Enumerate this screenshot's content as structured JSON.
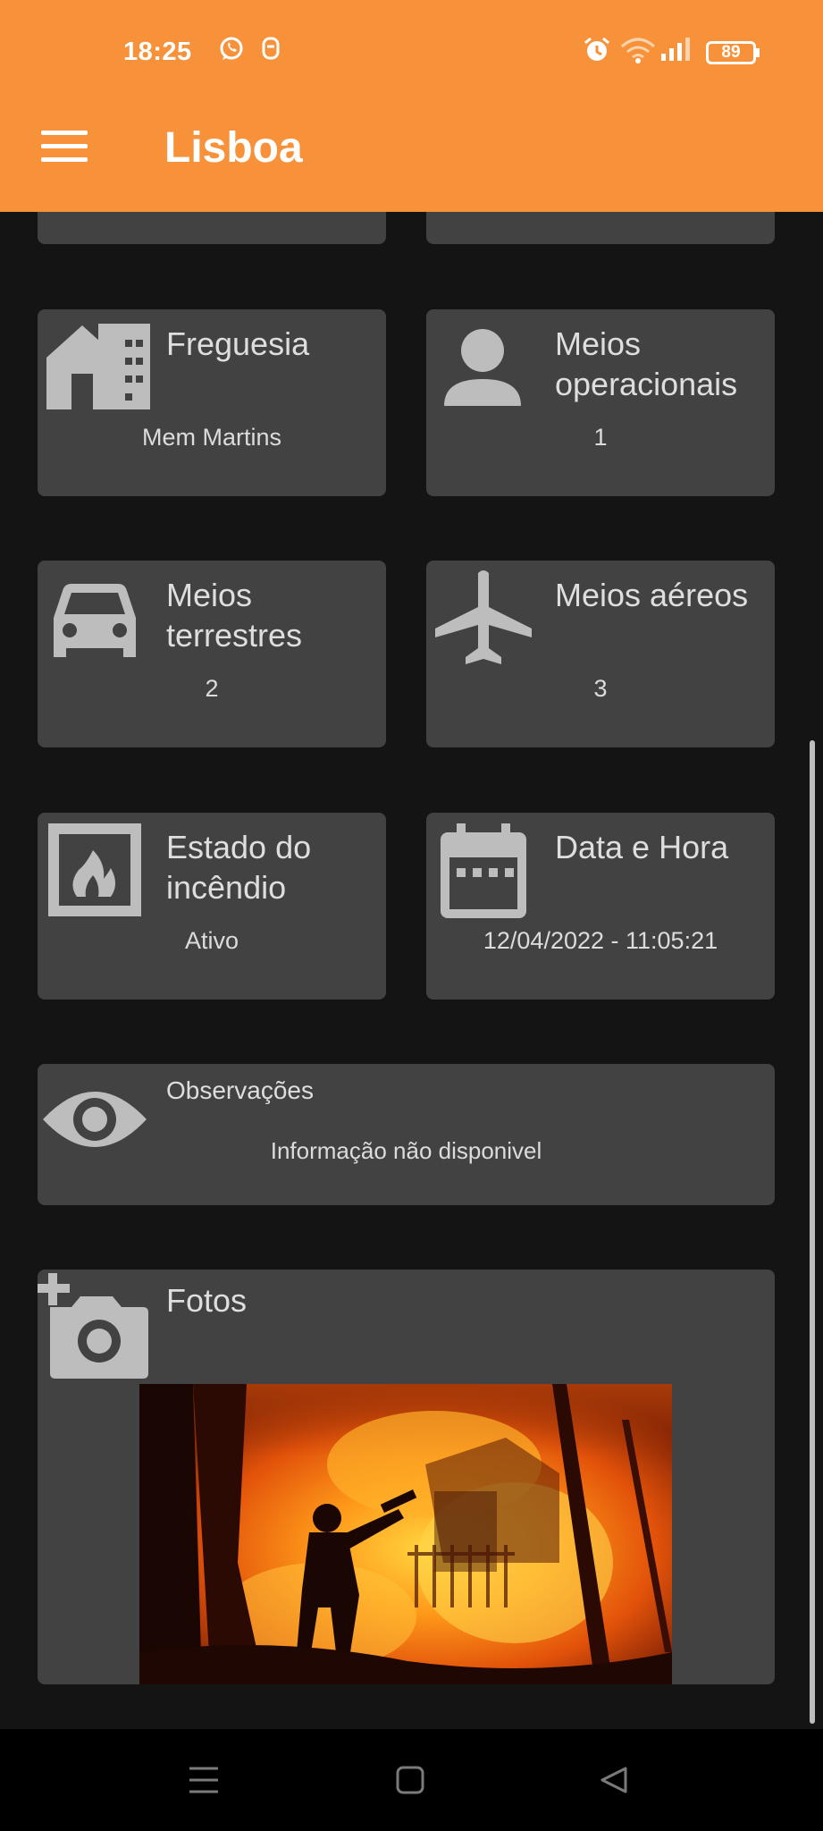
{
  "status_bar": {
    "time": "18:25",
    "battery": "89",
    "icons": [
      "whatsapp-icon",
      "notification-icon",
      "alarm-icon",
      "wifi-icon",
      "signal-icon",
      "battery-icon"
    ]
  },
  "header": {
    "title": "Lisboa",
    "menu_icon": "hamburger-menu-icon",
    "accent": "#f7923b"
  },
  "cards": {
    "freguesia": {
      "label": "Freguesia",
      "value": "Mem Martins",
      "icon": "house-icon"
    },
    "meios_operacionais": {
      "label": "Meios operacionais",
      "value": "1",
      "icon": "person-icon"
    },
    "meios_terrestres": {
      "label": "Meios terrestres",
      "value": "2",
      "icon": "car-icon"
    },
    "meios_aereos": {
      "label": "Meios aéreos",
      "value": "3",
      "icon": "airplane-icon"
    },
    "estado": {
      "label": "Estado do incêndio",
      "value": "Ativo",
      "icon": "fireplace-icon"
    },
    "data_hora": {
      "label": "Data e Hora",
      "value": "12/04/2022 - 11:05:21",
      "icon": "calendar-icon"
    },
    "observacoes": {
      "label": "Observações",
      "value": "Informação não disponivel",
      "icon": "eye-icon"
    },
    "fotos": {
      "label": "Fotos",
      "icon": "add-photo-icon",
      "photo": "forest-fire-photo"
    }
  },
  "colors": {
    "background": "#141414",
    "card": "#424242",
    "icon": "#bdbdbd"
  },
  "nav_bar": {
    "icons": [
      "recent-apps-icon",
      "home-icon",
      "back-icon"
    ]
  }
}
